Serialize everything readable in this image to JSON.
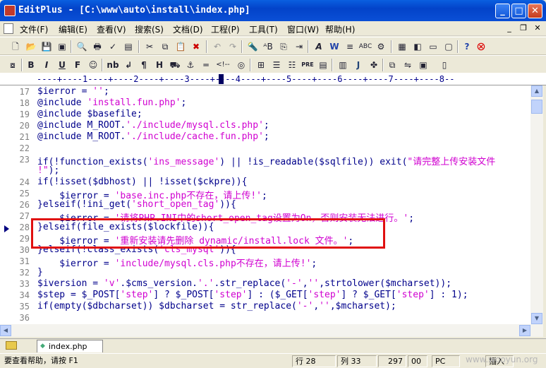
{
  "window": {
    "title": "EditPlus - [C:\\www\\auto\\install\\index.php]",
    "minimize_glyph": "_",
    "maximize_glyph": "□",
    "close_glyph": "✕"
  },
  "menu": {
    "items": [
      "文件(F)",
      "编辑(E)",
      "查看(V)",
      "搜索(S)",
      "文档(D)",
      "工程(P)",
      "工具(T)",
      "窗口(W)",
      "帮助(H)"
    ],
    "mdi_minimize": "_",
    "mdi_restore": "❐",
    "mdi_close": "✕"
  },
  "toolbar2": {
    "bold": "B",
    "italic": "I",
    "underline": "U",
    "font": "F",
    "nbsp": "nb",
    "br": "↲",
    "paragraph": "¶",
    "heading": "H",
    "anchor": "⚓",
    "hr": "═",
    "comment": "<!--",
    "pre": "PRE",
    "js": "J"
  },
  "ruler": {
    "text": "----+----1----+----2----+----3----+----4----+----5----+----6----+----7----+----8--"
  },
  "editor": {
    "lines": [
      {
        "n": "17",
        "parts": [
          [
            "c",
            "$ierror = "
          ],
          [
            "s",
            "''"
          ],
          [
            "c",
            ";"
          ]
        ]
      },
      {
        "n": "18",
        "parts": [
          [
            "c",
            "@include "
          ],
          [
            "s",
            "'install.fun.php'"
          ],
          [
            "c",
            ";"
          ]
        ]
      },
      {
        "n": "19",
        "parts": [
          [
            "c",
            "@include $basefile;"
          ]
        ]
      },
      {
        "n": "20",
        "parts": [
          [
            "c",
            "@include M_ROOT."
          ],
          [
            "s",
            "'./include/mysql.cls.php'"
          ],
          [
            "c",
            ";"
          ]
        ]
      },
      {
        "n": "21",
        "parts": [
          [
            "c",
            "@include M_ROOT."
          ],
          [
            "s",
            "'./include/cache.fun.php'"
          ],
          [
            "c",
            ";"
          ]
        ]
      },
      {
        "n": "22",
        "parts": []
      },
      {
        "n": "23",
        "parts": [
          [
            "c",
            "if(!function_exists("
          ],
          [
            "s",
            "'ins_message'"
          ],
          [
            "c",
            ") || !is_readable($sqlfile)) exit("
          ],
          [
            "s",
            "\"请完整上传安装文件"
          ]
        ]
      },
      {
        "n": "",
        "parts": [
          [
            "s",
            "!\""
          ],
          [
            "c",
            ");"
          ]
        ]
      },
      {
        "n": "24",
        "parts": [
          [
            "c",
            "if(!isset($dbhost) || !isset($ckpre)){"
          ]
        ]
      },
      {
        "n": "25",
        "parts": [
          [
            "c",
            "    $ierror = "
          ],
          [
            "s",
            "'base.inc.php不存在，请上传!'"
          ],
          [
            "c",
            ";"
          ]
        ]
      },
      {
        "n": "26",
        "parts": [
          [
            "c",
            "}elseif(!ini_get("
          ],
          [
            "s",
            "'short_open_tag'"
          ],
          [
            "c",
            ")){"
          ]
        ]
      },
      {
        "n": "27",
        "parts": [
          [
            "c",
            "    $ierror = "
          ],
          [
            "s",
            "'请将PHP.INI中的short_open_tag设置为On，否则安装无法进行。'"
          ],
          [
            "c",
            ";"
          ]
        ]
      },
      {
        "n": "28",
        "parts": [
          [
            "c",
            "}elseif(file_exists($lockfile)){"
          ]
        ]
      },
      {
        "n": "29",
        "parts": [
          [
            "c",
            "    $ierror = "
          ],
          [
            "s",
            "'重新安装请先删除 dynamic/install.lock 文件。'"
          ],
          [
            "c",
            ";"
          ]
        ]
      },
      {
        "n": "30",
        "parts": [
          [
            "c",
            "}elseif(!class_exists("
          ],
          [
            "s",
            "'cls_mysql'"
          ],
          [
            "c",
            ")){"
          ]
        ]
      },
      {
        "n": "31",
        "parts": [
          [
            "c",
            "    $ierror = "
          ],
          [
            "s",
            "'include/mysql.cls.php不存在，请上传!'"
          ],
          [
            "c",
            ";"
          ]
        ]
      },
      {
        "n": "32",
        "parts": [
          [
            "c",
            "}"
          ]
        ]
      },
      {
        "n": "33",
        "parts": [
          [
            "c",
            "$iversion = "
          ],
          [
            "s",
            "'v'"
          ],
          [
            "c",
            ".$cms_version."
          ],
          [
            "s",
            "'.'"
          ],
          [
            "c",
            ".str_replace("
          ],
          [
            "s",
            "'-'"
          ],
          [
            "c",
            ","
          ],
          [
            "s",
            "''"
          ],
          [
            "c",
            ",strtolower($mcharset));"
          ]
        ]
      },
      {
        "n": "34",
        "parts": [
          [
            "c",
            "$step = $_POST["
          ],
          [
            "s",
            "'step'"
          ],
          [
            "c",
            "] ? $_POST["
          ],
          [
            "s",
            "'step'"
          ],
          [
            "c",
            "] : ($_GET["
          ],
          [
            "s",
            "'step'"
          ],
          [
            "c",
            "] ? $_GET["
          ],
          [
            "s",
            "'step'"
          ],
          [
            "c",
            "] : 1);"
          ]
        ]
      },
      {
        "n": "35",
        "parts": [
          [
            "c",
            "if(empty($dbcharset)) $dbcharset = str_replace("
          ],
          [
            "s",
            "'-'"
          ],
          [
            "c",
            ","
          ],
          [
            "s",
            "''"
          ],
          [
            "c",
            ",$mcharset);"
          ]
        ]
      },
      {
        "n": "36",
        "parts": []
      }
    ]
  },
  "tabs": {
    "file": "index.php"
  },
  "status": {
    "help": "要查看帮助，请按 F1",
    "line": "行 28",
    "col": "列 33",
    "chars": "297",
    "num": "00",
    "pc": "PC",
    "ins": "插入"
  },
  "watermark": "www.wooyun.org"
}
